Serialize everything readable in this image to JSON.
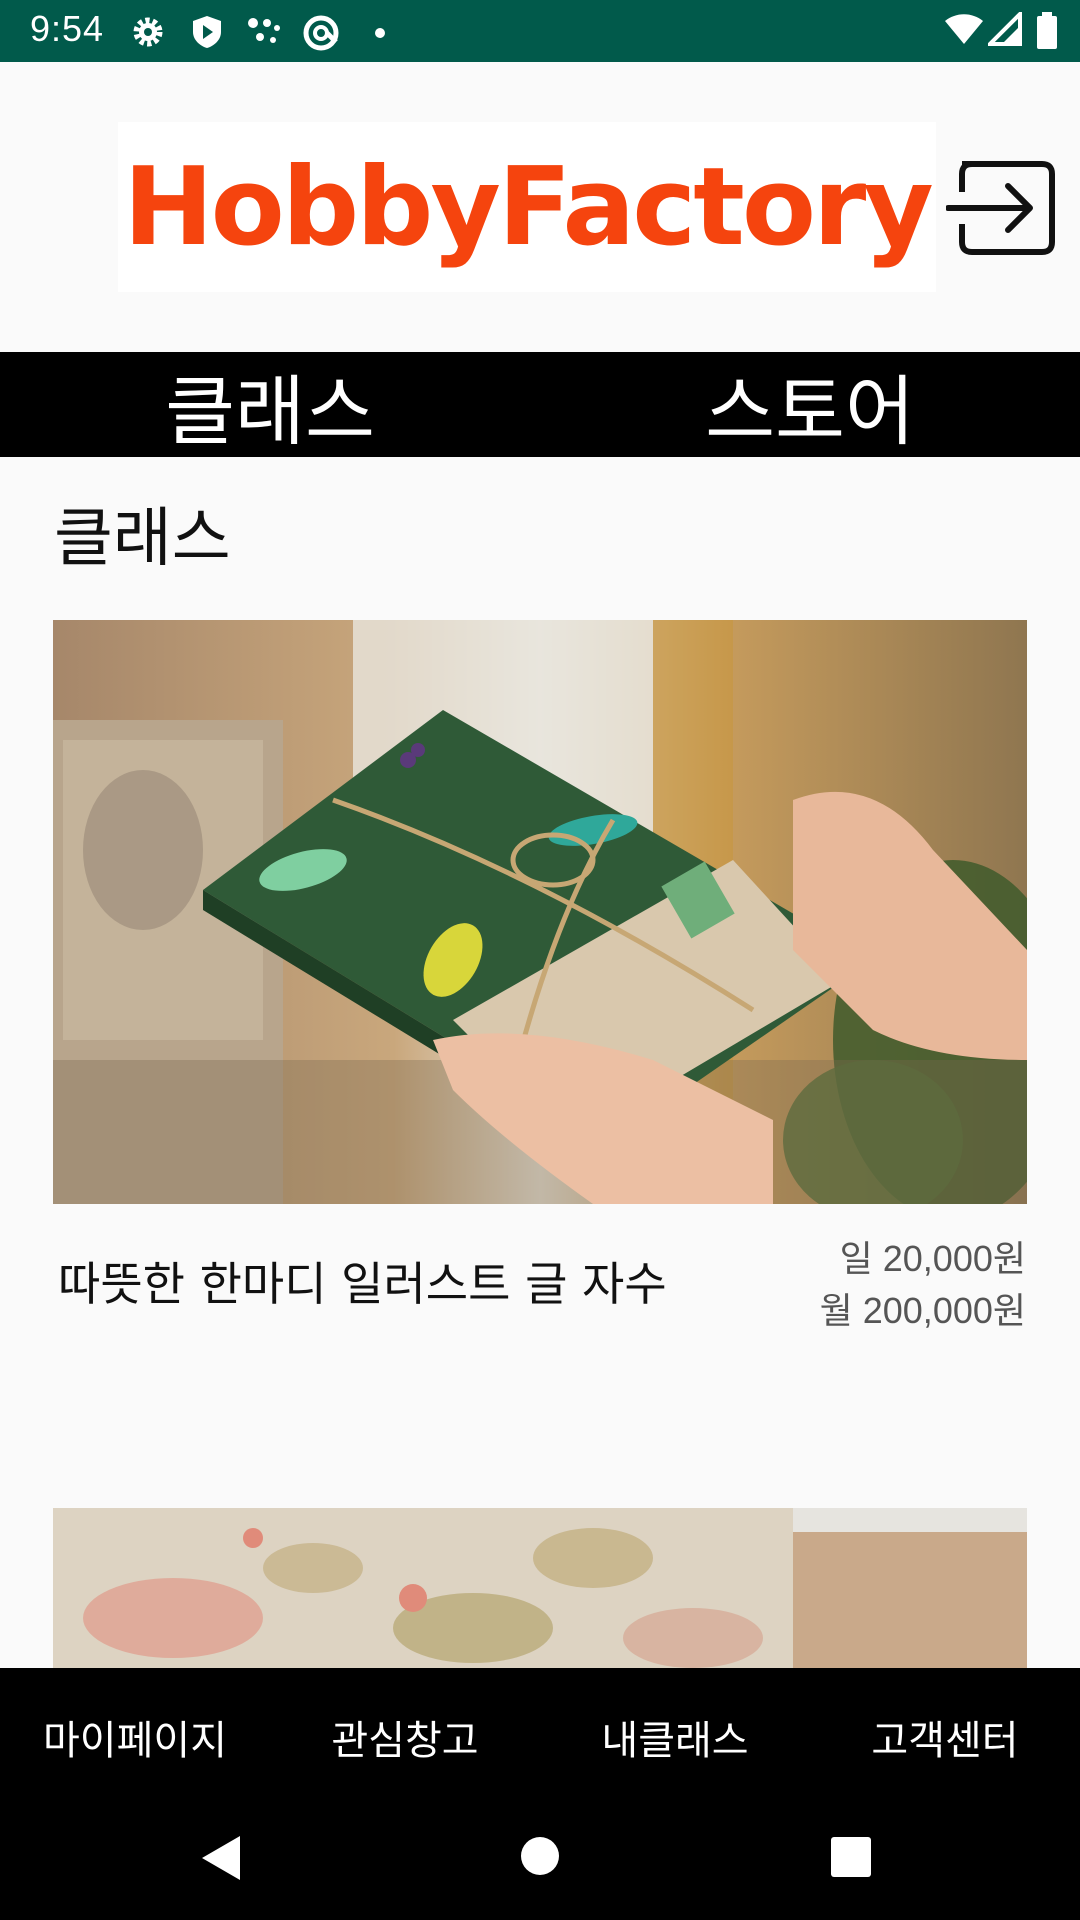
{
  "status_bar": {
    "time": "9:54",
    "icons": [
      "gear-icon",
      "shield-play-icon",
      "dots-icon",
      "at-sync-icon",
      "dot-icon",
      "wifi-icon",
      "signal-icon",
      "battery-icon"
    ]
  },
  "header": {
    "logo_text": "HobbyFactory",
    "logo_color": "#f5440e",
    "login_icon": "login-arrow-icon"
  },
  "top_tabs": [
    {
      "label": "클래스"
    },
    {
      "label": "스토어"
    }
  ],
  "section": {
    "title": "클래스"
  },
  "classes": [
    {
      "title": "따뜻한 한마디 일러스트 글 자수",
      "price_day": "일 20,000원",
      "price_month": "월 200,000원",
      "image": "embroidered-book-gift-photo"
    },
    {
      "image": "floral-fabric-photo"
    }
  ],
  "bottom_nav": [
    {
      "label": "마이페이지"
    },
    {
      "label": "관심창고"
    },
    {
      "label": "내클래스"
    },
    {
      "label": "고객센터"
    }
  ],
  "system_nav": [
    "back-icon",
    "home-icon",
    "recents-icon"
  ],
  "colors": {
    "status_bar": "#015a4b",
    "nav_background": "#000000",
    "page_background": "#fafafa"
  }
}
